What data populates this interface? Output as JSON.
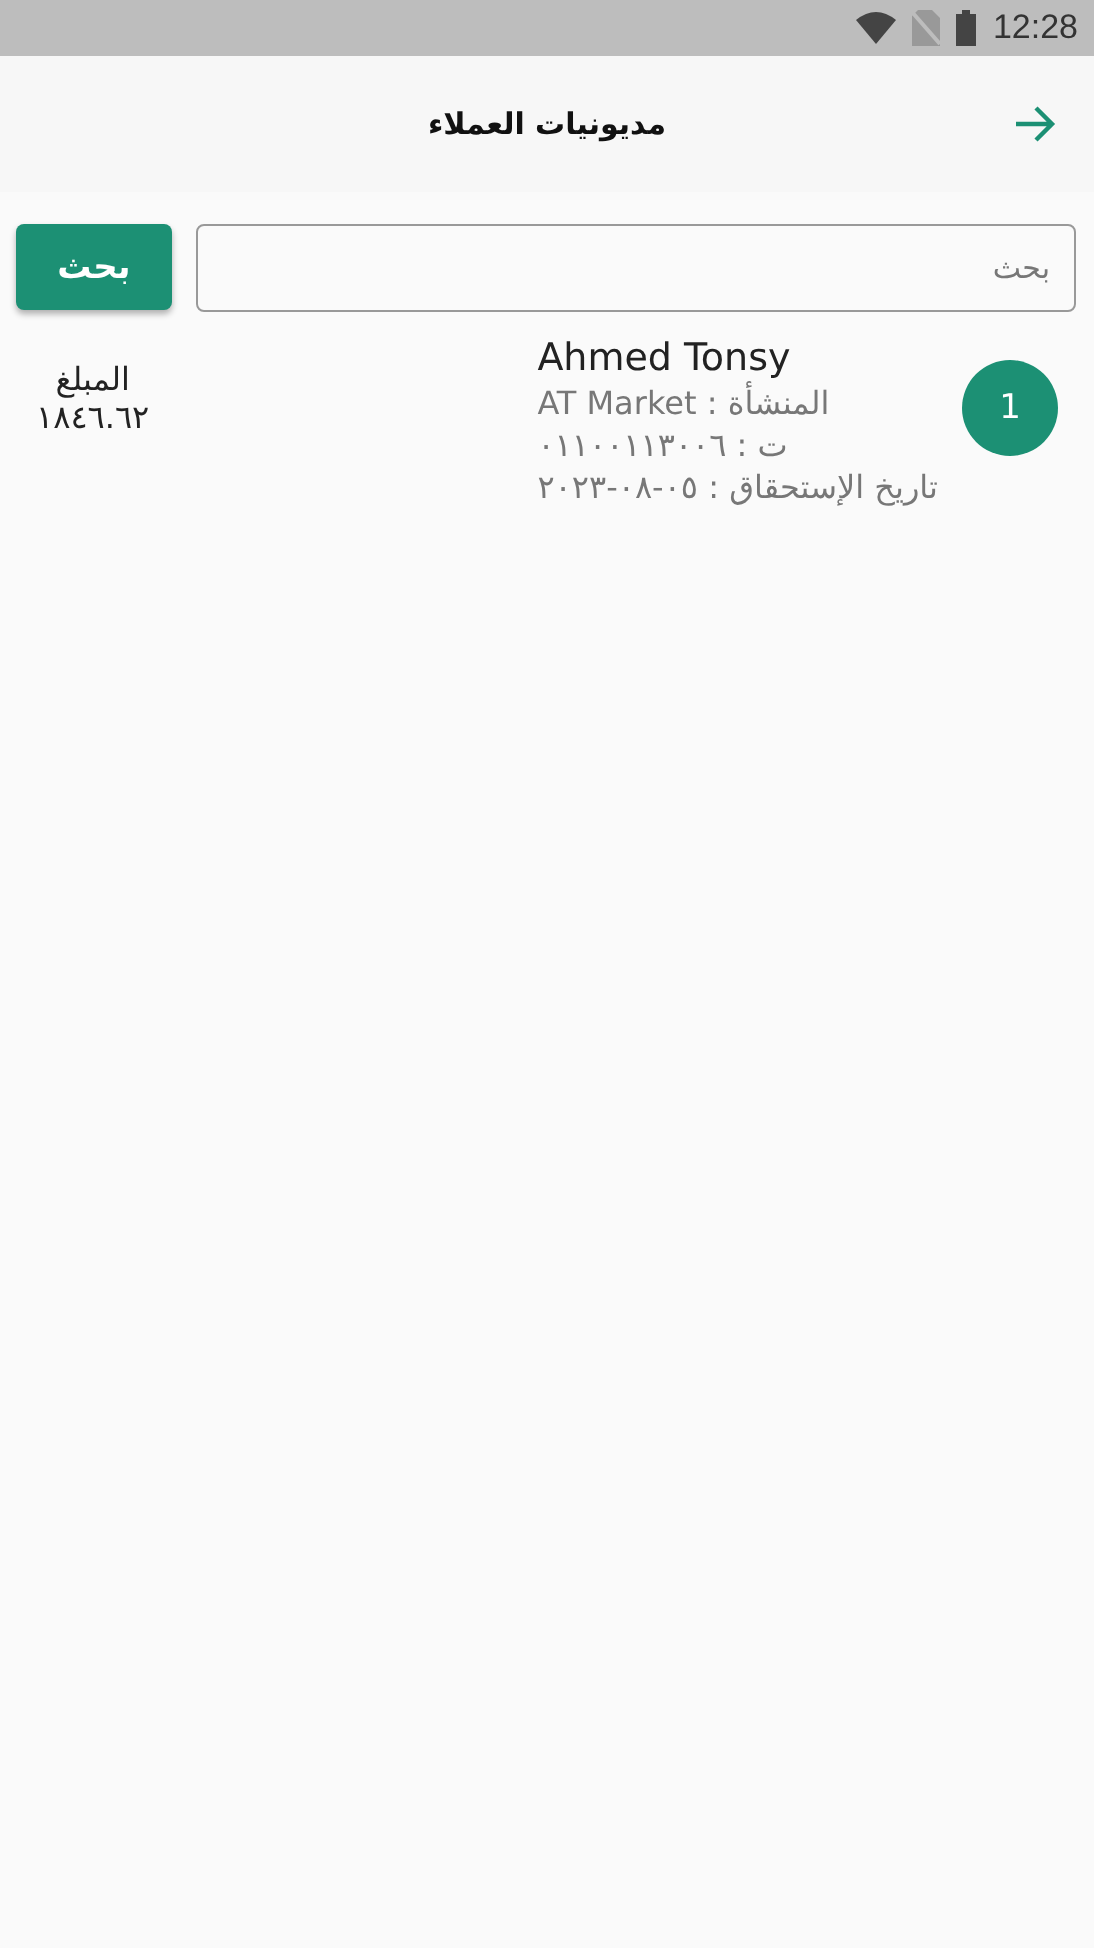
{
  "status_bar": {
    "time": "12:28"
  },
  "header": {
    "title": "مديونيات العملاء"
  },
  "search": {
    "placeholder": "بحث",
    "button": "بحث"
  },
  "customers": [
    {
      "index": "1",
      "name": "Ahmed Tonsy",
      "company": "المنشأة : AT Market",
      "phone": "ت : ٠١١٠٠١١٣٠٠٦",
      "due": "تاريخ الإستحقاق : ٠٥-٠٨-٢٠٢٣",
      "amount_label": "المبلغ",
      "amount": "١٨٤٦.٦٢"
    }
  ]
}
